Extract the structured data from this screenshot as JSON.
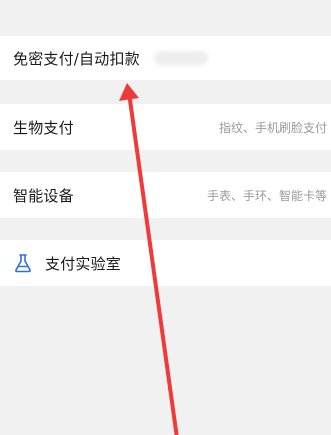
{
  "settings": {
    "items": [
      {
        "title": "免密支付/自动扣款",
        "subtitle": ""
      },
      {
        "title": "生物支付",
        "subtitle": "指纹、手机刷脸支付"
      },
      {
        "title": "智能设备",
        "subtitle": "手表、手环、智能卡等"
      },
      {
        "title": "支付实验室",
        "icon": "flask-icon"
      }
    ]
  },
  "colors": {
    "background": "#f1f1f1",
    "row": "#ffffff",
    "text": "#1a1a1a",
    "subtext": "#9a9a9a",
    "icon_blue": "#2f6fe4",
    "annotation_arrow": "#f03a3a"
  }
}
